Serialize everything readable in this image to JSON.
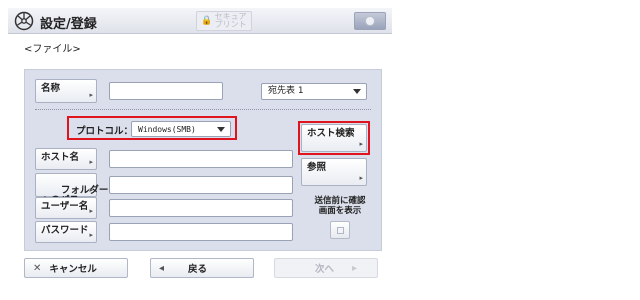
{
  "header": {
    "title": "設定/登録",
    "secure_print_label": "セキュア\nプリント",
    "icon_names": {
      "settings": "settings-gear-icon",
      "secure": "lock-icon",
      "right": "counter-check-icon"
    }
  },
  "subtitle": "<ファイル>",
  "form": {
    "name_button": "名称",
    "name_value": "",
    "address_book_select": "宛先表 1",
    "protocol_label": "プロトコル：",
    "protocol_value": "Windows(SMB)",
    "host_search_button": "ホスト検索",
    "host_name_button": "ホスト名",
    "host_name_value": "",
    "browse_button": "参照",
    "folder_path_button": "フォルダー\nへのパス",
    "folder_path_value": "",
    "user_name_button": "ユーザー名",
    "user_name_value": "",
    "confirm_before_send_label": "送信前に確認\n画面を表示",
    "password_button": "パスワード",
    "password_value": ""
  },
  "footer": {
    "cancel_button": "キャンセル",
    "back_button": "戻る",
    "next_button": "次へ"
  },
  "colors": {
    "highlight": "#e0141e",
    "panel_background": "#dadfeb"
  }
}
